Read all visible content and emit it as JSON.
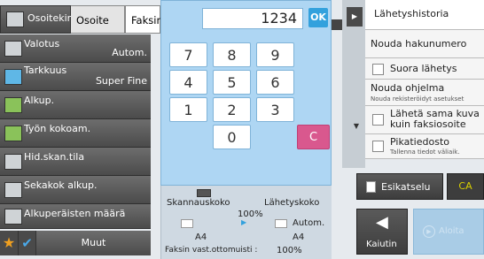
{
  "top": {
    "address_book_label": "Osoitekirja",
    "address_label": "Osoite",
    "fax_label": "Faksin"
  },
  "left_menu": [
    {
      "title": "Valotus",
      "value": "Autom.",
      "icon": "exposure-icon"
    },
    {
      "title": "Tarkkuus",
      "value": "Super Fine",
      "icon": "resolution-icon"
    },
    {
      "title": "Alkup.",
      "value": "",
      "icon": "original-icon"
    },
    {
      "title": "Työn kokoam.",
      "value": "",
      "icon": "job-build-icon"
    },
    {
      "title": "Hid.skan.tila",
      "value": "",
      "icon": "slow-scan-icon"
    },
    {
      "title": "Sekakok alkup.",
      "value": "",
      "icon": "mixed-size-icon"
    },
    {
      "title": "Alkuperäisten määrä",
      "value": "",
      "icon": "original-count-icon"
    }
  ],
  "bottom_left": {
    "more_label": "Muut"
  },
  "keypad": {
    "display_value": "1234",
    "ok_label": "OK",
    "keys": [
      "7",
      "8",
      "9",
      "4",
      "5",
      "6",
      "1",
      "2",
      "3",
      "0"
    ],
    "clear_label": "C"
  },
  "scan_info": {
    "scan_size_label": "Skannauskoko",
    "send_size_label": "Lähetyskoko",
    "ratio": "100%",
    "send_mode": "Autom.",
    "scan_paper": "A4",
    "send_paper": "A4",
    "memory_label": "Faksin vast.ottomuisti :",
    "memory_value": "100%"
  },
  "right_panel": {
    "history_label": "Lähetyshistoria",
    "polling_label": "Nouda hakunumero",
    "direct_send_label": "Suora lähetys",
    "call_program_label": "Nouda ohjelma",
    "call_program_sub": "Nouda rekisteröidyt asetukset",
    "same_image_label": "Lähetä sama kuva kuin faksiosoite",
    "quick_file_label": "Pikatiedosto",
    "quick_file_sub": "Tallenna tiedot väliaik."
  },
  "actions": {
    "preview_label": "Esikatselu",
    "ca_label": "CA",
    "speaker_label": "Kaiutin",
    "start_label": "Aloita"
  },
  "colors": {
    "ok": "#33a1dd",
    "clear": "#d9588e",
    "ca": "#d8ce00",
    "keypad_bg": "#aed6f3"
  }
}
